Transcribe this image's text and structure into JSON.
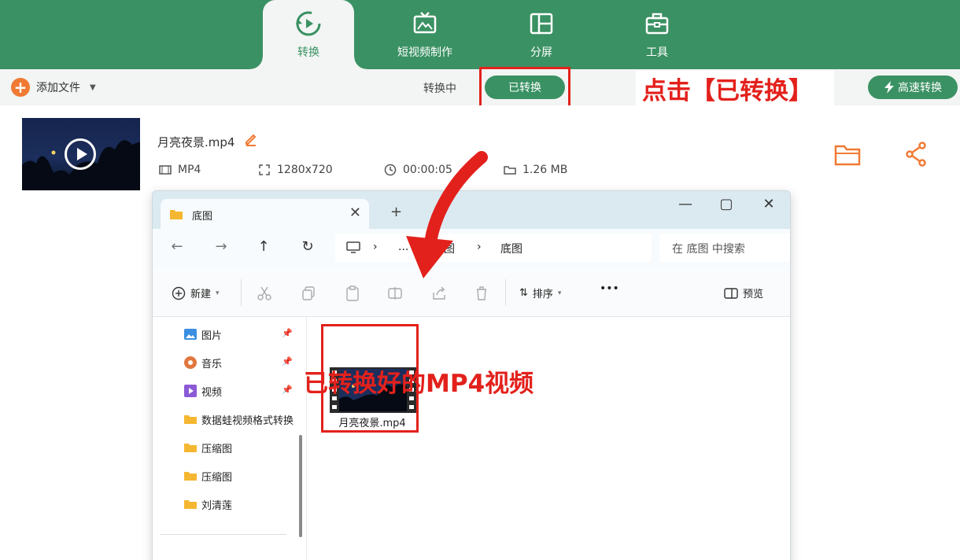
{
  "colors": {
    "brand_green": "#3a9163",
    "accent_orange": "#f07a34",
    "annotation_red": "#e3211c"
  },
  "header": {
    "tabs": [
      {
        "label": "转换",
        "icon": "convert-icon",
        "active": true
      },
      {
        "label": "短视频制作",
        "icon": "tv-icon",
        "active": false
      },
      {
        "label": "分屏",
        "icon": "split-screen-icon",
        "active": false
      },
      {
        "label": "工具",
        "icon": "toolbox-icon",
        "active": false
      }
    ]
  },
  "toolbar": {
    "add_file_label": "添加文件",
    "status_converting": "转换中",
    "status_converted": "已转换",
    "fast_convert_label": "高速转换"
  },
  "annotations": {
    "click_hint": "点击【已转换】",
    "result_hint": "已转换好的MP4视频"
  },
  "file": {
    "name": "月亮夜景.mp4",
    "format": "MP4",
    "resolution": "1280x720",
    "duration": "00:00:05",
    "size": "1.26 MB"
  },
  "explorer": {
    "tab_title": "底图",
    "new_tab_label": "+",
    "win_controls": {
      "minimize": "—",
      "maximize": "▢",
      "close": "✕"
    },
    "nav": {
      "back": "←",
      "forward": "→",
      "up": "↑",
      "refresh": "↻"
    },
    "breadcrumb": [
      "...",
      "封面图",
      "底图"
    ],
    "breadcrumb_sep": "›",
    "search_placeholder": "在 底图 中搜索",
    "commands": {
      "new_label": "新建",
      "sort_label": "排序",
      "more_label": "•••",
      "preview_label": "预览"
    },
    "sidebar": [
      {
        "label": "图片",
        "icon": "pictures-icon",
        "pinned": true
      },
      {
        "label": "音乐",
        "icon": "music-icon",
        "pinned": true
      },
      {
        "label": "视频",
        "icon": "videos-icon",
        "pinned": true
      },
      {
        "label": "数据蛙视频格式转换",
        "icon": "folder-icon",
        "pinned": false
      },
      {
        "label": "压缩图",
        "icon": "folder-icon",
        "pinned": false
      },
      {
        "label": "压缩图",
        "icon": "folder-icon",
        "pinned": false
      },
      {
        "label": "刘清莲",
        "icon": "folder-icon",
        "pinned": false
      }
    ],
    "pin_glyph": "📌",
    "file_label": "月亮夜景.mp4"
  }
}
